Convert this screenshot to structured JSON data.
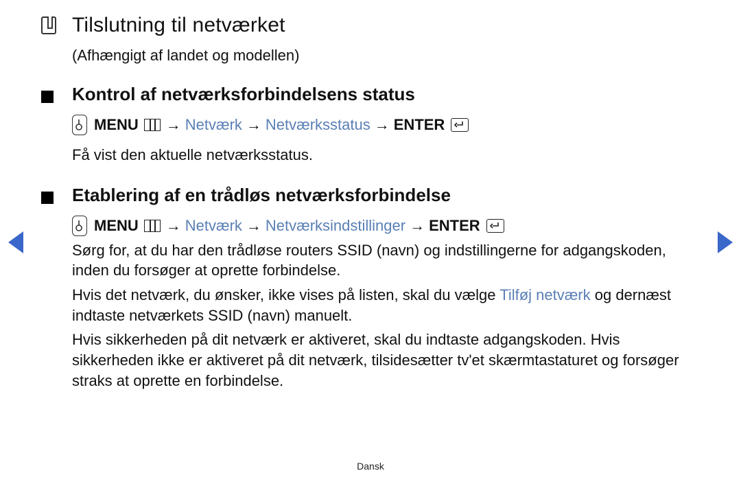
{
  "heading": {
    "title": "Tilslutning til netværket",
    "subtitle": "(Afhængigt af landet og modellen)"
  },
  "section1": {
    "heading": "Kontrol af netværksforbindelsens status",
    "nav": {
      "menu_label": "MENU",
      "step1": "Netværk",
      "step2": "Netværksstatus",
      "enter_label": "ENTER"
    },
    "body": "Få vist den aktuelle netværksstatus."
  },
  "section2": {
    "heading": "Etablering af en trådløs netværksforbindelse",
    "nav": {
      "menu_label": "MENU",
      "step1": "Netværk",
      "step2": "Netværksindstillinger",
      "enter_label": "ENTER"
    },
    "para1": "Sørg for, at du har den trådløse routers SSID (navn) og indstillingerne for adgangskoden, inden du forsøger at oprette forbindelse.",
    "para2_a": "Hvis det netværk, du ønsker, ikke vises på listen, skal du vælge ",
    "para2_link": "Tilføj netværk",
    "para2_b": " og dernæst indtaste netværkets SSID (navn) manuelt.",
    "para3": "Hvis sikkerheden på dit netværk er aktiveret, skal du indtaste adgangskoden. Hvis sikkerheden ikke er aktiveret på dit netværk, tilsidesætter tv'et skærmtastaturet og forsøger straks at oprette en forbindelse."
  },
  "symbols": {
    "arrow": "→"
  },
  "footer": "Dansk"
}
